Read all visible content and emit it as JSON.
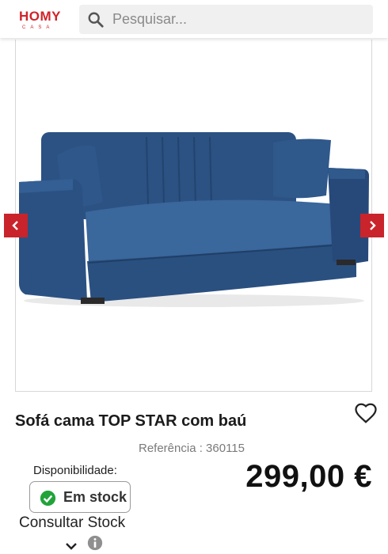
{
  "header": {
    "logo_main": "HOMY",
    "logo_sub": "CASA",
    "search": {
      "placeholder": "Pesquisar..."
    }
  },
  "colors": {
    "brand": "#d1232a",
    "stock_green": "#22a33a",
    "sofa_blue": "#2e5585"
  },
  "product": {
    "title": "Sofá cama TOP STAR com baú",
    "reference": "Referência : 360115",
    "availability_label": "Disponibilidade:",
    "stock_status": "Em stock",
    "price": "299,00 €",
    "consult_stock": "Consultar Stock"
  },
  "icons": {
    "search": "search-icon",
    "prev": "chevron-left-icon",
    "next": "chevron-right-icon",
    "favorite": "heart-icon",
    "stock": "check-circle-icon",
    "expand": "chevron-down-icon",
    "info": "info-icon"
  }
}
